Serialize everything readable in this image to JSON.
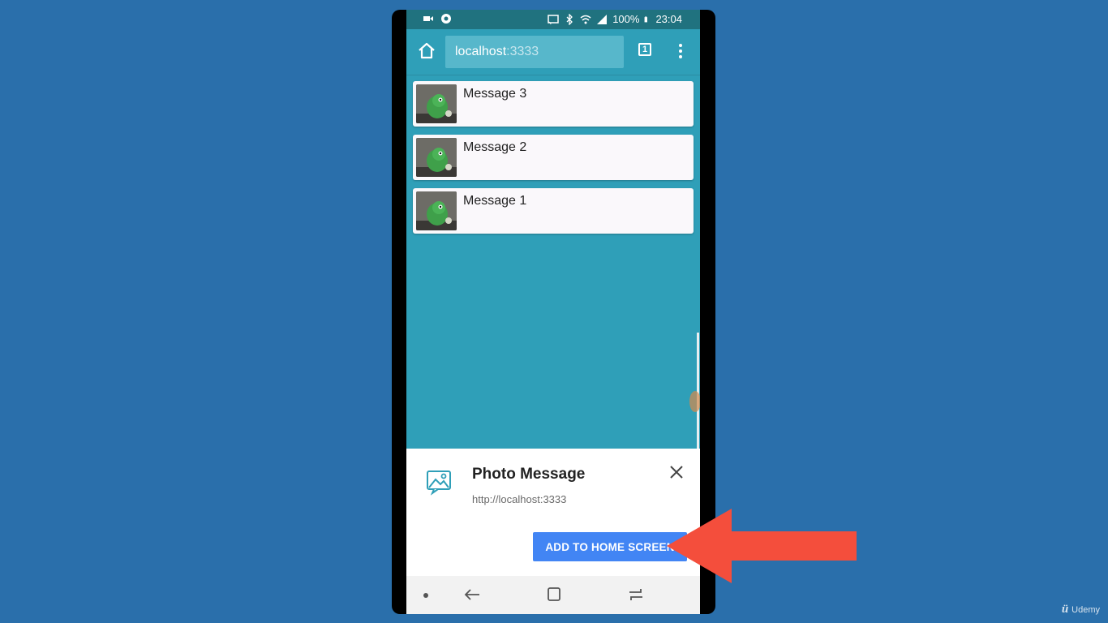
{
  "status_bar": {
    "battery": "100%",
    "time": "23:04"
  },
  "browser": {
    "url_host": "localhost",
    "url_port": ":3333",
    "tab_count": "1"
  },
  "messages": [
    {
      "title": "Message 3"
    },
    {
      "title": "Message 2"
    },
    {
      "title": "Message 1"
    }
  ],
  "install_prompt": {
    "app_name": "Photo Message",
    "app_url": "http://localhost:3333",
    "add_label": "ADD TO HOME SCREEN"
  },
  "watermark": {
    "brand": "Udemy"
  },
  "colors": {
    "page_bg": "#2a6fab",
    "app_bg": "#2f9fb8",
    "status_bar": "#20727f",
    "add_button": "#4285f4",
    "arrow": "#f44e3c"
  }
}
